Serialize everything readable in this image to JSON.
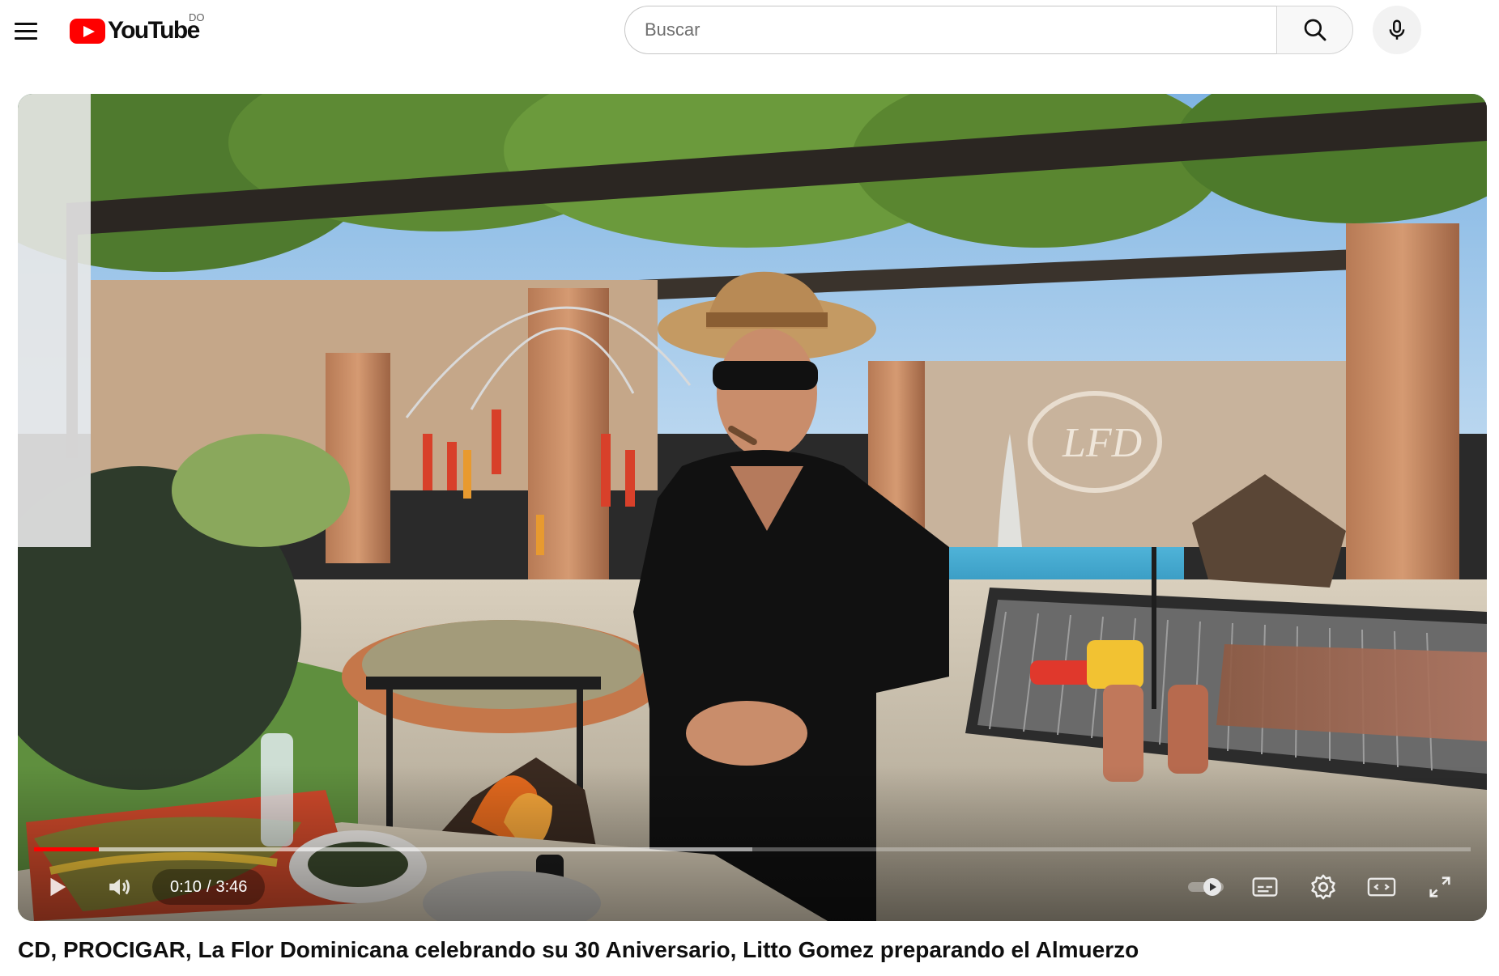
{
  "masthead": {
    "menu_icon": "hamburger-menu-icon",
    "logo_text": "YouTube",
    "country_code": "DO",
    "search": {
      "placeholder": "Buscar",
      "value": "",
      "button_icon": "search-icon"
    },
    "voice_icon": "microphone-icon"
  },
  "player": {
    "progress_fraction": 0.045,
    "buffered_fraction": 0.5,
    "current_time": "0:10",
    "separator": "/",
    "duration": "3:46",
    "controls": {
      "play_icon": "play-icon",
      "volume_icon": "volume-icon",
      "autoplay_icon": "autoplay-toggle-icon",
      "captions_icon": "subtitles-icon",
      "settings_icon": "gear-icon",
      "theater_icon": "theater-mode-icon",
      "fullscreen_icon": "fullscreen-icon"
    },
    "scene_sign_text": "LFD"
  },
  "video": {
    "title": "CD, PROCIGAR, La Flor Dominicana celebrando su 30 Aniversario, Litto Gomez preparando el Almuerzo"
  },
  "colors": {
    "brand_red": "#ff0000",
    "text_primary": "#0f0f0f",
    "text_secondary": "#606060"
  }
}
